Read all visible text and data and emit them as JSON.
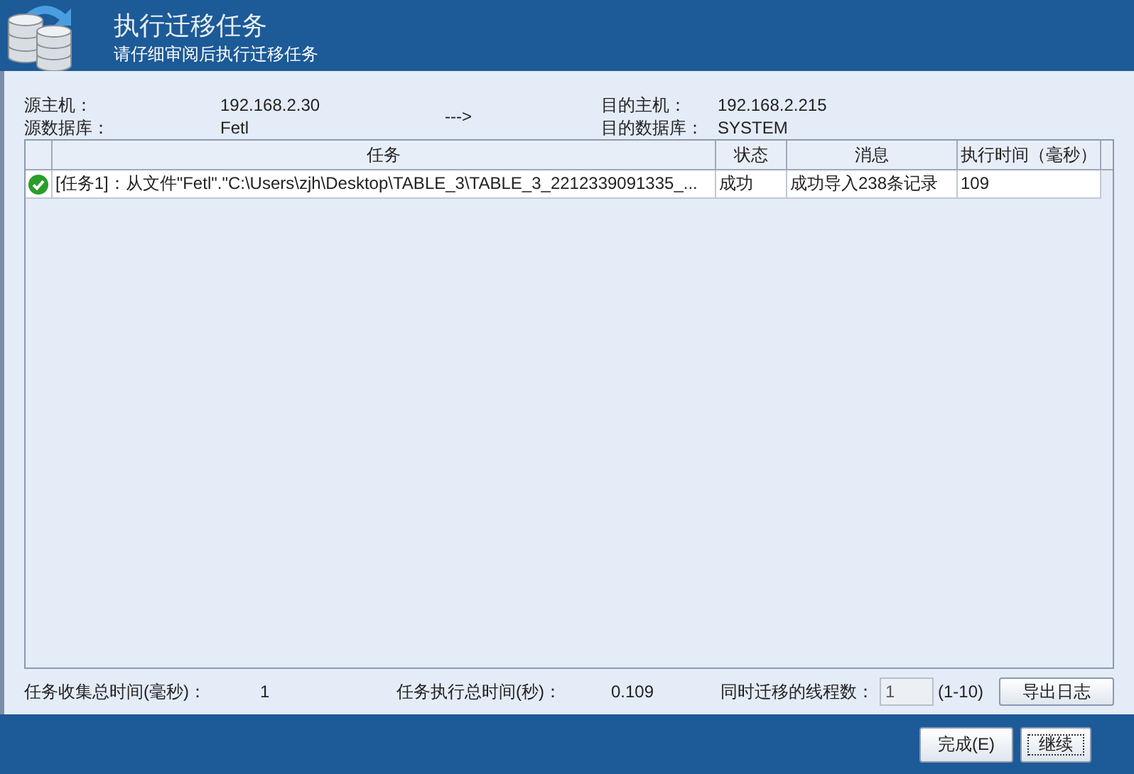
{
  "header": {
    "title": "执行迁移任务",
    "subtitle": "请仔细审阅后执行迁移任务"
  },
  "source": {
    "host_label": "源主机：",
    "host": "192.168.2.30",
    "db_label": "源数据库：",
    "db": "Fetl"
  },
  "arrow": "--->",
  "target": {
    "host_label": "目的主机：",
    "host": "192.168.2.215",
    "db_label": "目的数据库：",
    "db": "SYSTEM"
  },
  "table": {
    "columns": [
      "任务",
      "状态",
      "消息",
      "执行时间（毫秒）"
    ],
    "rows": [
      {
        "kind": "success",
        "task": "[任务1]：从文件\"Fetl\".\"C:\\Users\\zjh\\Desktop\\TABLE_3\\TABLE_3_2212339091335_...",
        "status": "成功",
        "message": "成功导入238条记录",
        "time": "109"
      }
    ]
  },
  "summary": {
    "collect_label": "任务收集总时间(毫秒)：",
    "collect_value": "1",
    "exec_label": "任务执行总时间(秒)：",
    "exec_value": "0.109",
    "threads_label": "同时迁移的线程数：",
    "threads_value": "1",
    "threads_range": "(1-10)",
    "export_button": "导出日志"
  },
  "buttons": [
    {
      "label": "完成(E)",
      "focused": false
    },
    {
      "label": "继续",
      "focused": true
    }
  ]
}
